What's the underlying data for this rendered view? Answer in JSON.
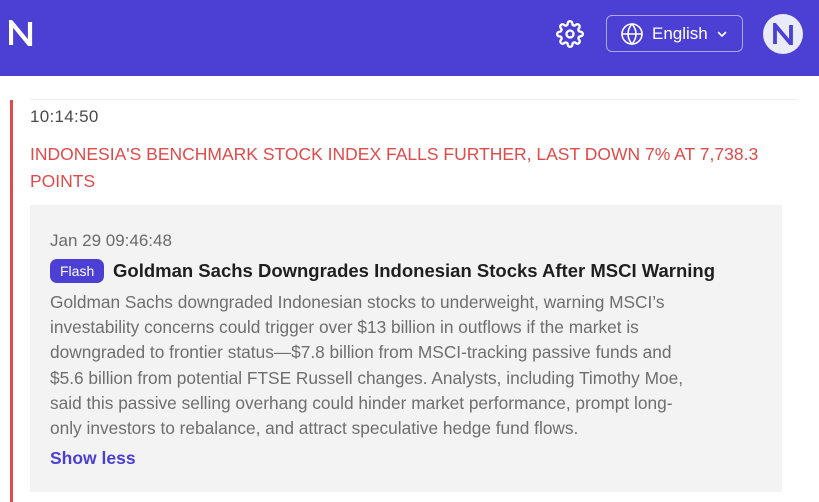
{
  "header": {
    "logo_icon": "n-logo-icon",
    "settings_icon": "gear-icon",
    "language": {
      "icon": "globe-icon",
      "label": "English",
      "chevron": "chevron-down-icon"
    },
    "avatar_icon": "n-logo-icon",
    "brand_color": "#4b3fd4"
  },
  "feed": {
    "time": "10:14:50",
    "headline": "INDONESIA'S BENCHMARK STOCK INDEX FALLS FURTHER, LAST DOWN 7% AT 7,738.3 POINTS",
    "accent_color": "#e04a4a",
    "card": {
      "date": "Jan 29 09:46:48",
      "badge": "Flash",
      "title": "Goldman Sachs Downgrades Indonesian Stocks After MSCI Warning",
      "body_lines": [
        "Goldman Sachs downgraded Indonesian stocks to underweight, warning MSCI’s",
        "investability concerns could trigger over $13 billion in outflows if the market is",
        "downgraded to frontier status—$7.8 billion from MSCI-tracking passive funds and",
        "$5.6 billion from potential FTSE Russell changes. Analysts, including Timothy Moe,",
        "said this passive selling overhang could hinder market performance, prompt long-",
        "only investors to rebalance, and attract speculative hedge fund flows."
      ],
      "toggle_label": "Show less"
    }
  }
}
